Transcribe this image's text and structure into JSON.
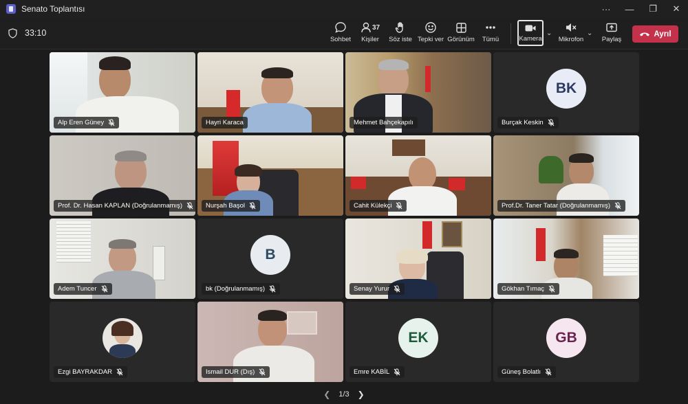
{
  "window": {
    "title": "Senato Toplantısı",
    "controls": {
      "more": "···",
      "minimize": "—",
      "maximize": "❐",
      "close": "✕"
    }
  },
  "toolbar": {
    "timer": "33:10",
    "chat_label": "Sohbet",
    "people_label": "Kişiler",
    "people_count": "37",
    "raise_label": "Söz iste",
    "react_label": "Tepki ver",
    "view_label": "Görünüm",
    "more_label": "Tümü",
    "camera_label": "Kamera",
    "mic_label": "Mikrofon",
    "share_label": "Paylaş",
    "leave_label": "Ayrıl"
  },
  "participants": [
    {
      "name": "Alp Eren Güney",
      "type": "video"
    },
    {
      "name": "Hayri Karaca",
      "type": "video",
      "active": true
    },
    {
      "name": "Mehmet Bahçekapılı",
      "type": "video"
    },
    {
      "name": "Burçak Keskin",
      "type": "avatar",
      "initials": "BK",
      "bg": "#e8ecf6",
      "fg": "#2c3a63"
    },
    {
      "name": "Prof. Dr. Hasan KAPLAN (Doğrulanmamış)",
      "type": "video"
    },
    {
      "name": "Nurşah Başol",
      "type": "video"
    },
    {
      "name": "Cahit Külekçi",
      "type": "video"
    },
    {
      "name": "Prof.Dr. Taner Tatar (Doğrulanmamış)",
      "type": "video"
    },
    {
      "name": "Adem Tuncer",
      "type": "video"
    },
    {
      "name": "bk (Doğrulanmamış)",
      "type": "avatar",
      "initials": "B",
      "bg": "#e8ecf0",
      "fg": "#2c4a63"
    },
    {
      "name": "Senay Yurur",
      "type": "video"
    },
    {
      "name": "Gökhan Tımaç",
      "type": "video"
    },
    {
      "name": "Ezgi BAYRAKDAR",
      "type": "photo"
    },
    {
      "name": "Ismail DUR (Dış)",
      "type": "video"
    },
    {
      "name": "Emre KABİL",
      "type": "avatar",
      "initials": "EK",
      "bg": "#e6f3ec",
      "fg": "#1f5a3a"
    },
    {
      "name": "Güneş Bolatlı",
      "type": "avatar",
      "initials": "GB",
      "bg": "#f6e6ef",
      "fg": "#6b2350"
    }
  ],
  "pager": {
    "label": "1/3"
  }
}
